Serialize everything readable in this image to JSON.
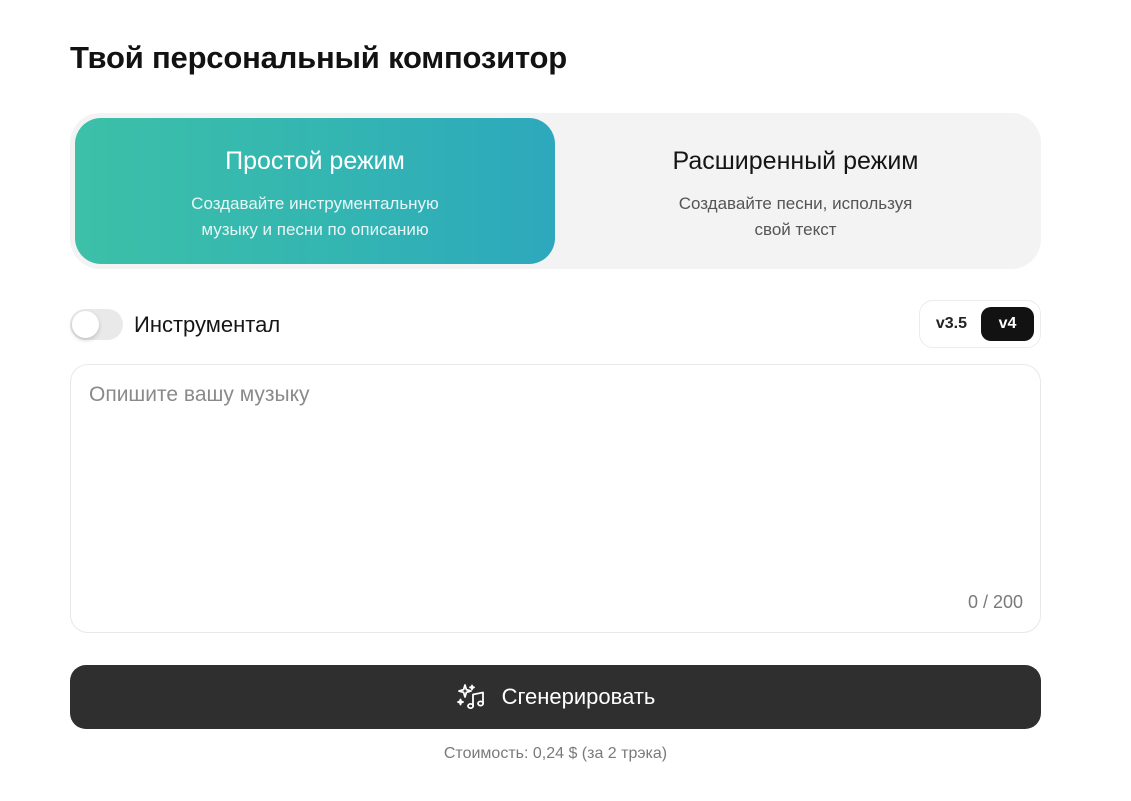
{
  "page": {
    "title": "Твой персональный композитор"
  },
  "modes": [
    {
      "title": "Простой режим",
      "description_line1": "Создавайте инструментальную",
      "description_line2": "музыку и песни по описанию",
      "active": true
    },
    {
      "title": "Расширенный режим",
      "description_line1": "Создавайте песни, используя",
      "description_line2": "свой текст",
      "active": false
    }
  ],
  "instrumental_toggle": {
    "label": "Инструментал",
    "on": false
  },
  "versions": {
    "options": [
      "v3.5",
      "v4"
    ],
    "selected": "v4"
  },
  "description_input": {
    "placeholder": "Опишите вашу музыку",
    "value": "",
    "counter": "0 / 200"
  },
  "generate_button": {
    "label": "Сгенерировать",
    "icon": "sparkle-music-icon"
  },
  "cost": {
    "text": "Стоимость: 0,24 $ (за 2 трэка)"
  },
  "colors": {
    "accent_gradient_start": "#3cc0a7",
    "accent_gradient_end": "#2da8bd",
    "button_dark": "#2f2f2f",
    "version_active": "#121212"
  }
}
